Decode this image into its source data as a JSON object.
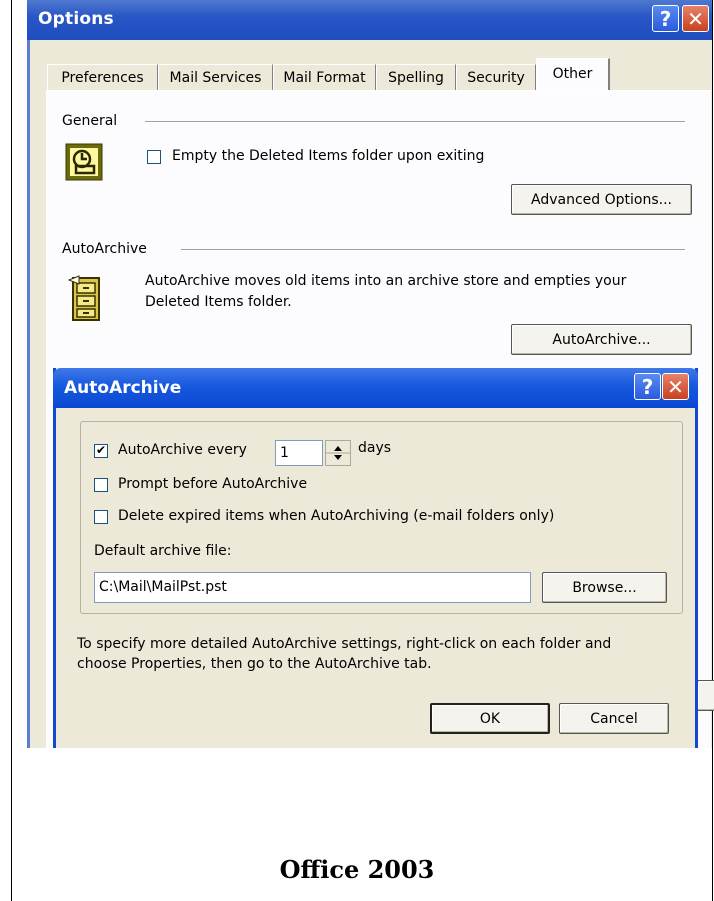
{
  "options_window": {
    "title": "Options",
    "tabs": [
      "Preferences",
      "Mail Services",
      "Mail Format",
      "Spelling",
      "Security",
      "Other"
    ],
    "active_tab": "Other",
    "general": {
      "heading": "General",
      "empty_deleted_label": "Empty the Deleted Items folder upon exiting",
      "empty_deleted_checked": false,
      "advanced_button": "Advanced Options..."
    },
    "autoarchive": {
      "heading": "AutoArchive",
      "description_line1": "AutoArchive moves old items into an archive store and empties your",
      "description_line2": "Deleted Items folder.",
      "button": "AutoArchive..."
    }
  },
  "autoarchive_dialog": {
    "title": "AutoArchive",
    "every_label": "AutoArchive every",
    "every_checked": true,
    "every_value": "1",
    "days_label": "days",
    "prompt_label": "Prompt before AutoArchive",
    "prompt_checked": false,
    "delete_expired_label": "Delete expired items when AutoArchiving (e-mail folders only)",
    "delete_expired_checked": false,
    "default_file_label": "Default archive file:",
    "default_file_value": "C:\\Mail\\MailPst.pst",
    "browse_button": "Browse...",
    "hint_line1": "To specify more detailed AutoArchive settings, right-click on each folder and",
    "hint_line2": "choose Properties, then go to the AutoArchive tab.",
    "ok_button": "OK",
    "cancel_button": "Cancel"
  },
  "caption": "Office 2003",
  "colors": {
    "titlebar_blue": "#1f4cc0",
    "dialog_face": "#ece9d8",
    "close_red": "#c8401e"
  }
}
